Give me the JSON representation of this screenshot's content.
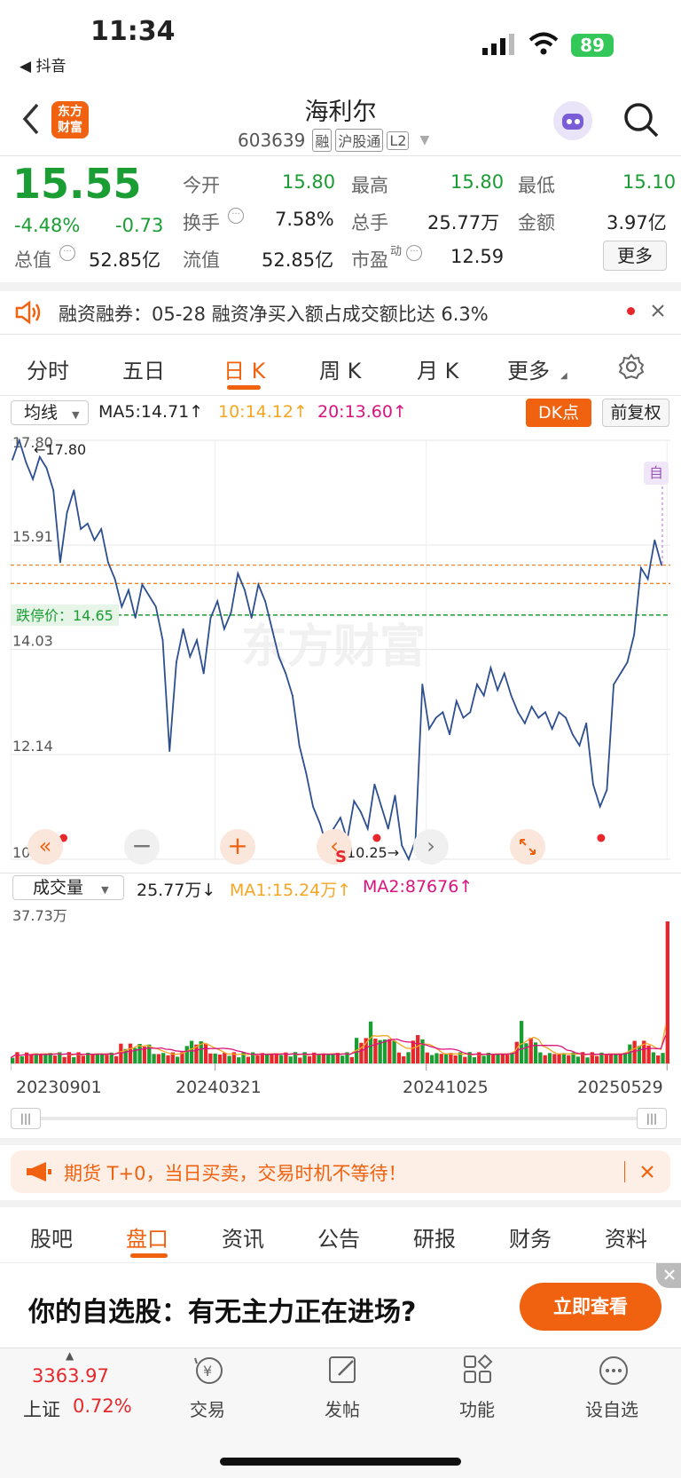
{
  "status_bar": {
    "time": "11:34",
    "back_app": "◀ 抖音",
    "battery": "89"
  },
  "header": {
    "logo_line1": "东方",
    "logo_line2": "财富",
    "title": "海利尔",
    "code": "603639",
    "tags": [
      "融",
      "沪股通",
      "L2"
    ]
  },
  "quote": {
    "price": "15.55",
    "change_pct": "-4.48%",
    "change": "-0.73",
    "open_label": "今开",
    "open": "15.80",
    "high_label": "最高",
    "high": "15.80",
    "low_label": "最低",
    "low": "15.10",
    "turnover_label": "换手",
    "turnover": "7.58%",
    "volume_label": "总手",
    "volume": "25.77万",
    "amount_label": "金额",
    "amount": "3.97亿",
    "mktcap_label": "总值",
    "mktcap": "52.85亿",
    "float_label": "流值",
    "float": "52.85亿",
    "pe_label": "市盈",
    "pe_sup": "动",
    "pe": "12.59",
    "more": "更多"
  },
  "notice": {
    "text": "融资融券：05-28 融资净买入额占成交额比达 6.3%"
  },
  "chart_tabs": [
    "分时",
    "五日",
    "日 K",
    "周 K",
    "月 K",
    "更多"
  ],
  "active_chart_tab": "日 K",
  "ma_bar": {
    "select": "均线",
    "ma5": "MA5:14.71↑",
    "ma10": "10:14.12↑",
    "ma20": "20:13.60↑",
    "dk": "DK点",
    "adjust": "前复权"
  },
  "kline": {
    "y_labels": [
      "17.80",
      "15.91",
      "14.03",
      "12.14",
      "10.25"
    ],
    "high_marker": "17.80",
    "low_marker": "10.25",
    "limit_down_label": "跌停价：14.65",
    "self_tag": "自",
    "watermark": "东方财富",
    "s_mark": "S"
  },
  "vol_bar": {
    "select": "成交量",
    "vol": "25.77万↓",
    "ma1": "MA1:15.24万↑",
    "ma2": "MA2:87676↑",
    "max_label": "37.73万"
  },
  "dates": [
    "20230901",
    "20240321",
    "20241025",
    "20250529"
  ],
  "ad_banner": {
    "text": "期货 T+0，当日买卖，交易时机不等待！"
  },
  "bottom_tabs": [
    "股吧",
    "盘口",
    "资讯",
    "公告",
    "研报",
    "财务",
    "资料"
  ],
  "active_bottom_tab": "盘口",
  "promo": {
    "text": "你的自选股：有无主力正在进场?",
    "button": "立即查看"
  },
  "footer": {
    "index_value": "3363.97",
    "index_name": "上证",
    "index_change": "0.72%",
    "items": [
      "交易",
      "发帖",
      "功能",
      "设自选"
    ]
  },
  "colors": {
    "up": "#e8272b",
    "down": "#1a9d33",
    "accent": "#f0620f",
    "line": "#2d4f8f"
  },
  "chart_data": {
    "type": "line",
    "title": "",
    "x_labels": [
      "20230901",
      "20240321",
      "20241025",
      "20250529"
    ],
    "ylim": [
      10.25,
      17.8
    ],
    "y_ticks": [
      17.8,
      15.91,
      14.03,
      12.14,
      10.25
    ],
    "reference_lines": {
      "limit_down": 14.65
    },
    "series": [
      {
        "values": [
          17.45,
          17.8,
          17.4,
          17.1,
          17.5,
          17.3,
          16.9,
          15.6,
          16.5,
          16.9,
          16.2,
          16.3,
          16.0,
          16.2,
          15.6,
          15.3,
          14.8,
          15.1,
          14.6,
          15.2,
          15.0,
          14.8,
          14.2,
          12.2,
          13.8,
          14.4,
          13.9,
          14.2,
          13.6,
          14.6,
          14.9,
          14.4,
          14.7,
          15.4,
          15.1,
          14.6,
          15.2,
          14.9,
          14.4,
          13.9,
          13.6,
          13.2,
          12.3,
          11.8,
          11.2,
          10.9,
          10.5,
          10.8,
          11.0,
          10.6,
          11.3,
          11.1,
          10.8,
          11.6,
          11.2,
          10.8,
          11.4,
          10.5,
          10.25,
          10.6,
          13.4,
          12.6,
          12.8,
          12.9,
          12.5,
          13.1,
          12.8,
          12.9,
          13.4,
          13.2,
          13.7,
          13.3,
          13.6,
          13.2,
          12.9,
          12.7,
          13.0,
          12.8,
          12.9,
          12.6,
          12.9,
          12.8,
          12.5,
          12.3,
          12.7,
          11.6,
          11.2,
          11.5,
          13.4,
          13.6,
          13.8,
          14.3,
          15.5,
          15.3,
          16.0,
          15.55
        ]
      }
    ],
    "volume": {
      "max_label": "37.73万",
      "last": "25.77万",
      "ma1": "15.24万",
      "ma2": "87676"
    }
  }
}
